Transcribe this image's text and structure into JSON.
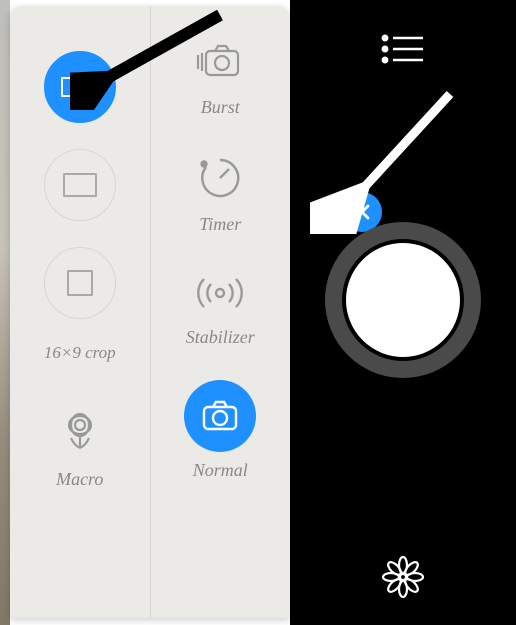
{
  "panel": {
    "crop_options": [
      {
        "id": "crop-16x9",
        "label": "",
        "active": true
      },
      {
        "id": "crop-4x3",
        "label": "",
        "active": false
      },
      {
        "id": "crop-1x1",
        "label": "",
        "active": false
      }
    ],
    "crop_footer_label": "16×9 crop",
    "camera_options": {
      "burst": {
        "label": "Burst"
      },
      "timer": {
        "label": "Timer"
      },
      "stabilizer": {
        "label": "Stabilizer"
      },
      "macro": {
        "label": "Macro"
      },
      "normal": {
        "label": "Normal",
        "active": true
      }
    }
  },
  "rightbar": {
    "close": "✕"
  },
  "colors": {
    "accent": "#1e90ff"
  }
}
